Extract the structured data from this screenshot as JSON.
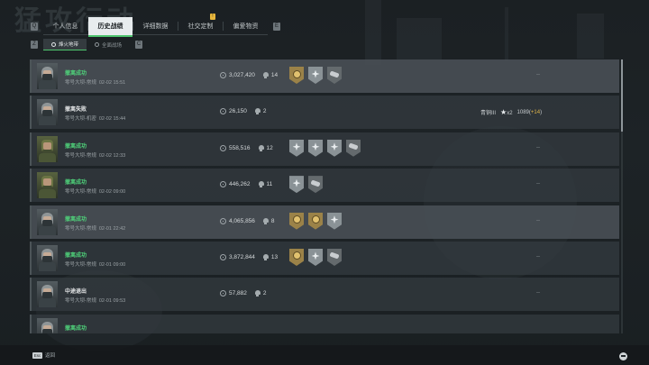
{
  "background_title": "猛攻行动",
  "tabs": {
    "prev_key": "Q",
    "next_key": "E",
    "items": [
      {
        "label": "个人信息",
        "active": false
      },
      {
        "label": "历史战绩",
        "active": true
      },
      {
        "label": "详细数据",
        "active": false
      },
      {
        "label": "社交定制",
        "active": false,
        "badge": "!"
      },
      {
        "label": "偏爱物资",
        "active": false
      }
    ]
  },
  "subtabs": {
    "prev_key": "Z",
    "next_key": "C",
    "items": [
      {
        "label": "烽火地带",
        "active": true
      },
      {
        "label": "全面战场",
        "active": false
      }
    ]
  },
  "matches": [
    {
      "status": "撤离成功",
      "status_type": "success",
      "map": "零号大坝-常规",
      "time": "02-02 15:51",
      "value": "3,027,420",
      "kills": "14",
      "medals": [
        "gold",
        "silver",
        "bronze"
      ],
      "reward": null,
      "dash": "--",
      "avatar": "masked",
      "highlight": true
    },
    {
      "status": "撤离失败",
      "status_type": "fail",
      "map": "零号大坝-机密",
      "time": "02-02 15:44",
      "value": "26,150",
      "kills": "2",
      "medals": [],
      "reward": {
        "rank": "青铜III",
        "stars": "x2",
        "score": "1089",
        "delta": "+14"
      },
      "dash": null,
      "avatar": "masked",
      "highlight": false
    },
    {
      "status": "撤离成功",
      "status_type": "success",
      "map": "零号大坝-常规",
      "time": "02-02 12:33",
      "value": "558,516",
      "kills": "12",
      "medals": [
        "silver",
        "silver",
        "silver",
        "bronze"
      ],
      "reward": null,
      "dash": "--",
      "avatar": "soldier",
      "highlight": false
    },
    {
      "status": "撤离成功",
      "status_type": "success",
      "map": "零号大坝-常规",
      "time": "02-02 09:00",
      "value": "446,262",
      "kills": "11",
      "medals": [
        "silver",
        "bronze"
      ],
      "reward": null,
      "dash": "--",
      "avatar": "soldier",
      "highlight": false
    },
    {
      "status": "撤离成功",
      "status_type": "success",
      "map": "零号大坝-常规",
      "time": "02-01 22:42",
      "value": "4,065,856",
      "kills": "8",
      "medals": [
        "gold",
        "gold",
        "silver"
      ],
      "reward": null,
      "dash": "--",
      "avatar": "masked",
      "highlight": true
    },
    {
      "status": "撤离成功",
      "status_type": "success",
      "map": "零号大坝-常规",
      "time": "02-01 09:00",
      "value": "3,872,844",
      "kills": "13",
      "medals": [
        "gold",
        "silver",
        "bronze"
      ],
      "reward": null,
      "dash": "--",
      "avatar": "masked",
      "highlight": false
    },
    {
      "status": "中途退出",
      "status_type": "neutral",
      "map": "零号大坝-常规",
      "time": "02-01 09:53",
      "value": "57,882",
      "kills": "2",
      "medals": [],
      "reward": null,
      "dash": "--",
      "avatar": "masked",
      "highlight": false
    },
    {
      "status": "撤离成功",
      "status_type": "success",
      "map": "",
      "time": "",
      "value": "",
      "kills": "",
      "medals": [],
      "reward": null,
      "dash": null,
      "avatar": "masked",
      "highlight": false
    }
  ],
  "footer": {
    "esc_key": "Esc",
    "esc_label": "返回"
  }
}
